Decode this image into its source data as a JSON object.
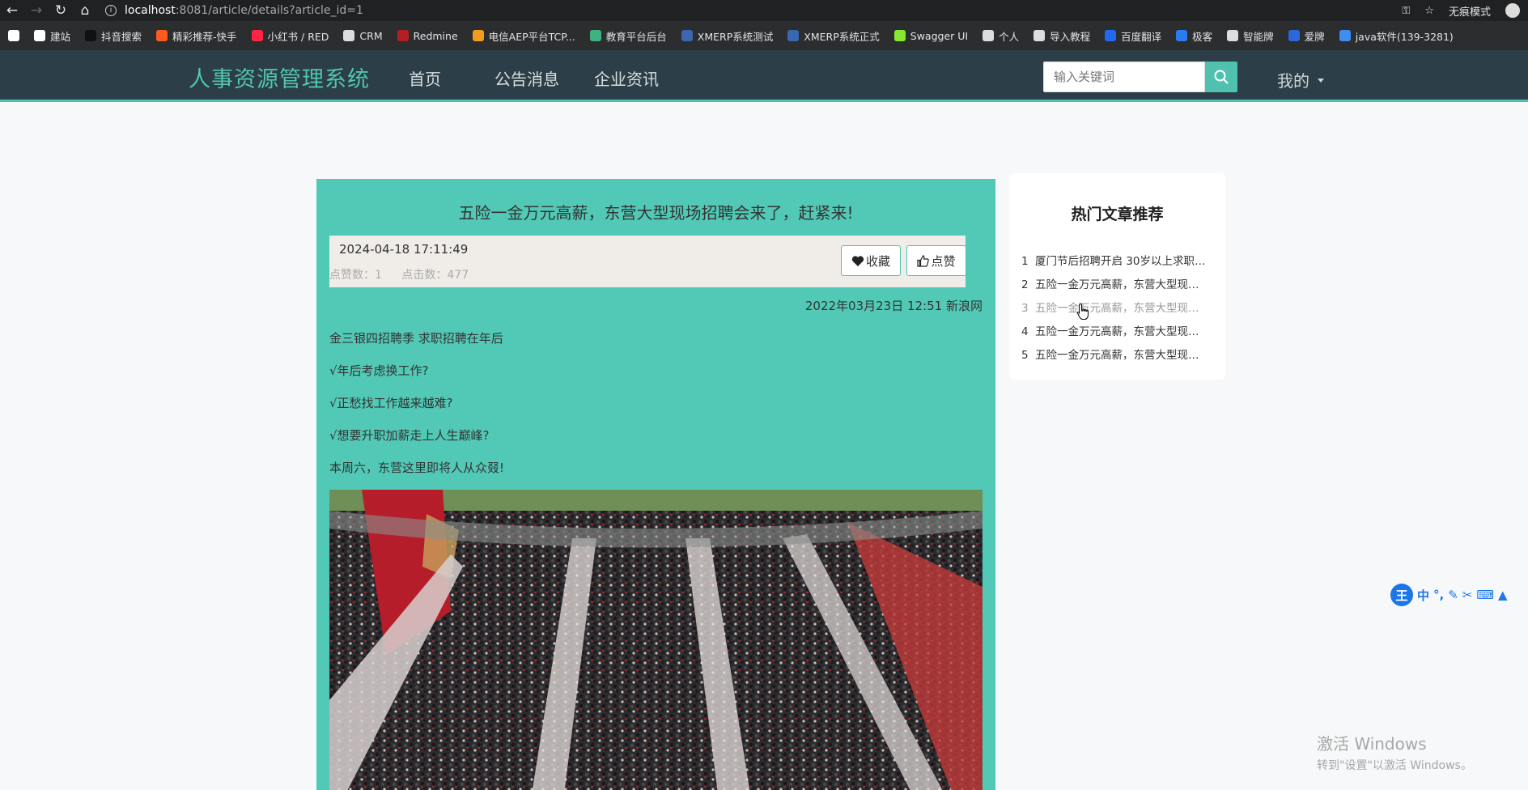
{
  "browser": {
    "url_host": "localhost",
    "url_rest": ":8081/article/details?article_id=1",
    "incognito_label": "无痕模式"
  },
  "bookmarks": [
    {
      "label": "",
      "color": "#ffffff"
    },
    {
      "label": "建站",
      "color": "#ffffff"
    },
    {
      "label": "抖音搜索",
      "color": "#111111"
    },
    {
      "label": "精彩推荐-快手",
      "color": "#ff5a1f"
    },
    {
      "label": "小红书 / RED",
      "color": "#ff2442"
    },
    {
      "label": "CRM",
      "color": "#dddddd"
    },
    {
      "label": "Redmine",
      "color": "#b32024"
    },
    {
      "label": "电信AEP平台TCP...",
      "color": "#f29c1f"
    },
    {
      "label": "教育平台后台",
      "color": "#3fb27f"
    },
    {
      "label": "XMERP系统测试",
      "color": "#3a67b0"
    },
    {
      "label": "XMERP系统正式",
      "color": "#3a67b0"
    },
    {
      "label": "Swagger UI",
      "color": "#85ea2d"
    },
    {
      "label": "个人",
      "color": "#dddddd"
    },
    {
      "label": "导入教程",
      "color": "#dddddd"
    },
    {
      "label": "百度翻译",
      "color": "#2468f2"
    },
    {
      "label": "极客",
      "color": "#2b7bf5"
    },
    {
      "label": "智能牌",
      "color": "#dddddd"
    },
    {
      "label": "爱牌",
      "color": "#2b67d9"
    },
    {
      "label": "java软件(139-3281)",
      "color": "#3d8ef0"
    }
  ],
  "nav": {
    "brand": "人事资源管理系统",
    "menu": [
      "首页",
      "公告消息",
      "企业资讯"
    ],
    "search_placeholder": "输入关键词",
    "user_label": "我的"
  },
  "article": {
    "title": "五险一金万元高薪，东营大型现场招聘会来了，赶紧来!",
    "date": "2024-04-18 17:11:49",
    "likes_label": "点赞数：",
    "likes": "1",
    "clicks_label": "点击数：",
    "clicks": "477",
    "favorite_label": "收藏",
    "like_label": "点赞",
    "source": "2022年03月23日 12:51 新浪网",
    "paragraphs": [
      "金三银四招聘季 求职招聘在年后",
      "√年后考虑换工作?",
      "√正愁找工作越来越难?",
      "√想要升职加薪走上人生巅峰?",
      "本周六，东营这里即将人从众叕!"
    ]
  },
  "hot": {
    "title": "热门文章推荐",
    "items": [
      {
        "num": "1",
        "text": "厦门节后招聘开启 30岁以上求职者..."
      },
      {
        "num": "2",
        "text": "五险一金万元高薪，东营大型现场..."
      },
      {
        "num": "3",
        "text": "五险一金万元高薪，东营大型现场..."
      },
      {
        "num": "4",
        "text": "五险一金万元高薪，东营大型现场..."
      },
      {
        "num": "5",
        "text": "五险一金万元高薪，东营大型现场..."
      }
    ]
  },
  "ime": {
    "logo": "王",
    "lang": "中"
  },
  "watermark": {
    "line1": "激活 Windows",
    "line2": "转到\"设置\"以激活 Windows。"
  }
}
